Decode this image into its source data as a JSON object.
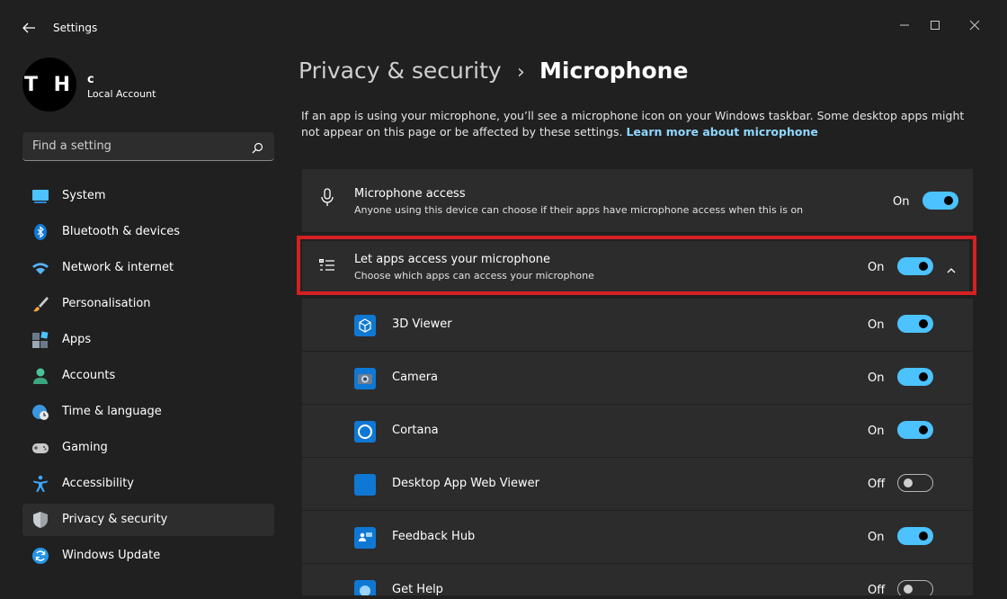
{
  "window": {
    "app_title": "Settings",
    "back_icon": "arrow-left-icon",
    "controls": [
      "minimize-icon",
      "maximize-icon",
      "close-icon"
    ]
  },
  "profile": {
    "avatar_text": "T H",
    "name": "c",
    "account_type": "Local Account"
  },
  "search": {
    "placeholder": "Find a setting",
    "icon": "search-icon"
  },
  "sidebar": {
    "items": [
      {
        "label": "System",
        "icon": "system-icon",
        "color": "#4cc2ff"
      },
      {
        "label": "Bluetooth & devices",
        "icon": "bluetooth-icon",
        "color": "#0f78d4"
      },
      {
        "label": "Network & internet",
        "icon": "wifi-icon",
        "color": "#56b4ff"
      },
      {
        "label": "Personalisation",
        "icon": "brush-icon",
        "color": "#f2a33a"
      },
      {
        "label": "Apps",
        "icon": "apps-icon",
        "color": "#9ba7b4"
      },
      {
        "label": "Accounts",
        "icon": "accounts-icon",
        "color": "#49c49a"
      },
      {
        "label": "Time & language",
        "icon": "globe-clock-icon",
        "color": "#3a96dd"
      },
      {
        "label": "Gaming",
        "icon": "gamepad-icon",
        "color": "#c8c8c8"
      },
      {
        "label": "Accessibility",
        "icon": "accessibility-icon",
        "color": "#3da7ff"
      },
      {
        "label": "Privacy & security",
        "icon": "shield-icon",
        "color": "#9ea3a8"
      },
      {
        "label": "Windows Update",
        "icon": "update-icon",
        "color": "#2596e8"
      }
    ],
    "active_item": "Privacy & security"
  },
  "breadcrumb": {
    "parent": "Privacy & security",
    "separator": "›",
    "current": "Microphone"
  },
  "description": {
    "text": "If an app is using your microphone, you’ll see a microphone icon on your Windows taskbar. Some desktop apps might not appear on this page or be affected by these settings. ",
    "link": "Learn more about microphone"
  },
  "microphone_access": {
    "title": "Microphone access",
    "subtitle": "Anyone using this device can choose if their apps have microphone access when this is on",
    "state": "On",
    "icon": "microphone-icon"
  },
  "let_apps_access": {
    "title": "Let apps access your microphone",
    "subtitle": "Choose which apps can access your microphone",
    "state": "On",
    "icon": "list-icon",
    "expand_icon": "chevron-up-icon"
  },
  "apps": [
    {
      "name": "3D Viewer",
      "state": "On",
      "icon": "cube-icon"
    },
    {
      "name": "Camera",
      "state": "On",
      "icon": "camera-icon"
    },
    {
      "name": "Cortana",
      "state": "On",
      "icon": "cortana-icon"
    },
    {
      "name": "Desktop App Web Viewer",
      "state": "Off",
      "icon": "web-viewer-icon"
    },
    {
      "name": "Feedback Hub",
      "state": "On",
      "icon": "feedback-hub-icon"
    },
    {
      "name": "Get Help",
      "state": "Off",
      "icon": "get-help-icon"
    }
  ],
  "colors": {
    "accent": "#4cc2ff",
    "highlight": "#d62023",
    "link": "#8fd7ff",
    "background": "#202020",
    "card": "#2c2c2c"
  }
}
